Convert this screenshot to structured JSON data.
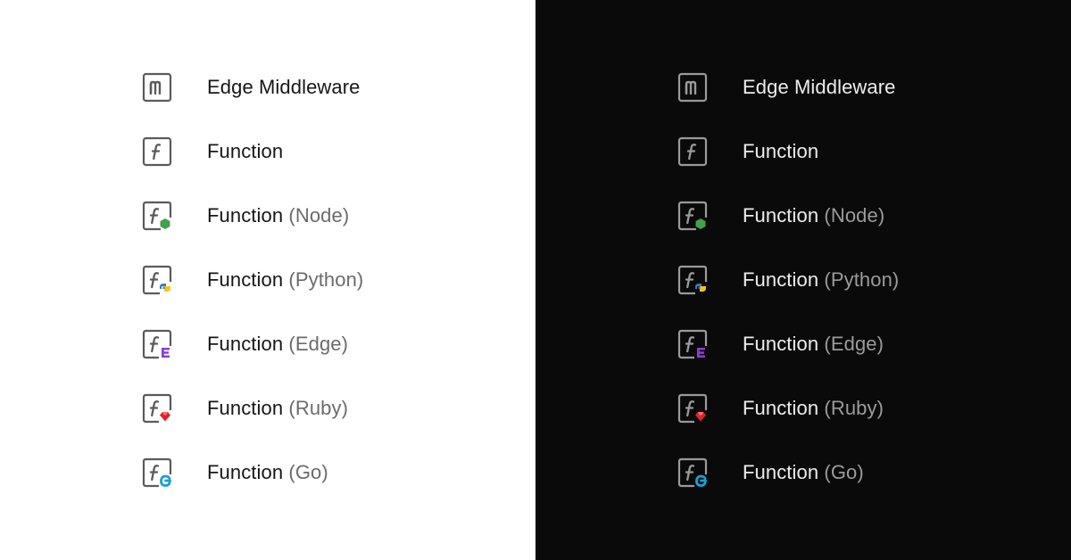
{
  "light": {
    "items": [
      {
        "primary": "Edge Middleware",
        "secondary": "",
        "icon": "middleware-icon"
      },
      {
        "primary": "Function",
        "secondary": "",
        "icon": "function-icon"
      },
      {
        "primary": "Function",
        "secondary": "(Node)",
        "icon": "function-node-icon"
      },
      {
        "primary": "Function",
        "secondary": "(Python)",
        "icon": "function-python-icon"
      },
      {
        "primary": "Function",
        "secondary": "(Edge)",
        "icon": "function-edge-icon"
      },
      {
        "primary": "Function",
        "secondary": "(Ruby)",
        "icon": "function-ruby-icon"
      },
      {
        "primary": "Function",
        "secondary": "(Go)",
        "icon": "function-go-icon"
      }
    ]
  },
  "dark": {
    "items": [
      {
        "primary": "Edge Middleware",
        "secondary": "",
        "icon": "middleware-icon"
      },
      {
        "primary": "Function",
        "secondary": "",
        "icon": "function-icon"
      },
      {
        "primary": "Function",
        "secondary": "(Node)",
        "icon": "function-node-icon"
      },
      {
        "primary": "Function",
        "secondary": "(Python)",
        "icon": "function-python-icon"
      },
      {
        "primary": "Function",
        "secondary": "(Edge)",
        "icon": "function-edge-icon"
      },
      {
        "primary": "Function",
        "secondary": "(Ruby)",
        "icon": "function-ruby-icon"
      },
      {
        "primary": "Function",
        "secondary": "(Go)",
        "icon": "function-go-icon"
      }
    ]
  },
  "colors": {
    "light_background": "#ffffff",
    "dark_background": "#0a0a0a",
    "node_badge": "#3fa34d",
    "python_badge_blue": "#3b78c4",
    "python_badge_yellow": "#f5c518",
    "edge_badge": "#8a3fd0",
    "ruby_badge": "#e0232e",
    "go_badge": "#1a9fd6"
  }
}
